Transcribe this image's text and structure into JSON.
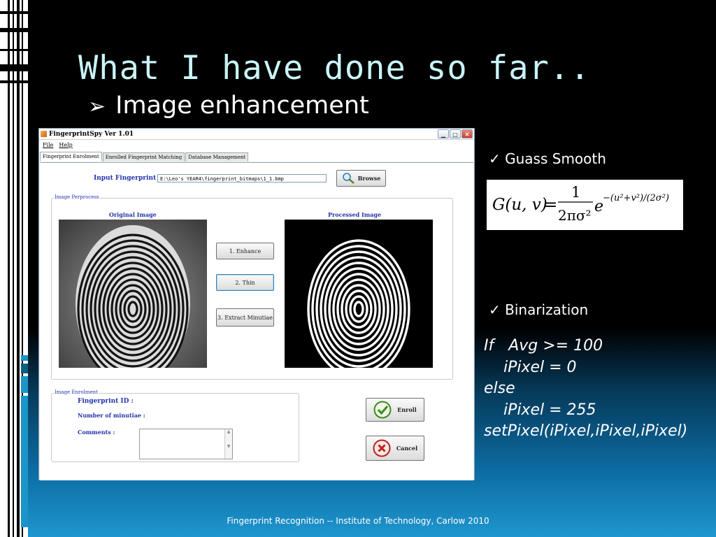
{
  "slide": {
    "title": "What I have done so far..",
    "bullet": "Image enhancement",
    "footer": "Fingerprint Recognition -- Institute of Technology, Carlow  2010"
  },
  "app": {
    "window_title": "FingerprintSpy Ver 1.01",
    "menu": [
      "File",
      "Help"
    ],
    "tabs": [
      "Fingerprint Enrolment",
      "Enrolled Fingerprint Matching",
      "Database Management"
    ],
    "input_label": "Input Fingerprint :",
    "input_path": "E:\\Leo's YEAR4\\fingerprint_bitmaps\\1_1.bmp",
    "browse_label": "Browse",
    "preprocess_group": "Image Perprocess",
    "original_label": "Original Image",
    "processed_label": "Processed Image",
    "steps": [
      "1. Enhance",
      "2. Thin",
      "3. Extract Minutiae"
    ],
    "enrolment_group": "Image Enrolment",
    "fingerprint_id_label": "Fingerprint ID :",
    "minutiae_label": "Number of minutiae :",
    "comments_label": "Comments :",
    "enroll_label": "Enroll",
    "cancel_label": "Cancel"
  },
  "notes": {
    "gauss_title": "Guass Smooth",
    "gauss_formula": "G(u,v) = 1/(2πσ²) e^−(u²+v²)/(2σ²)",
    "binarization_title": "Binarization",
    "code_lines": [
      "If   Avg >= 100",
      "    iPixel = 0",
      "else",
      "    iPixel = 255",
      "setPixel(iPixel,iPixel,iPixel)"
    ]
  },
  "colors": {
    "title": "#c9f4f8",
    "label_blue": "#2233aa"
  }
}
